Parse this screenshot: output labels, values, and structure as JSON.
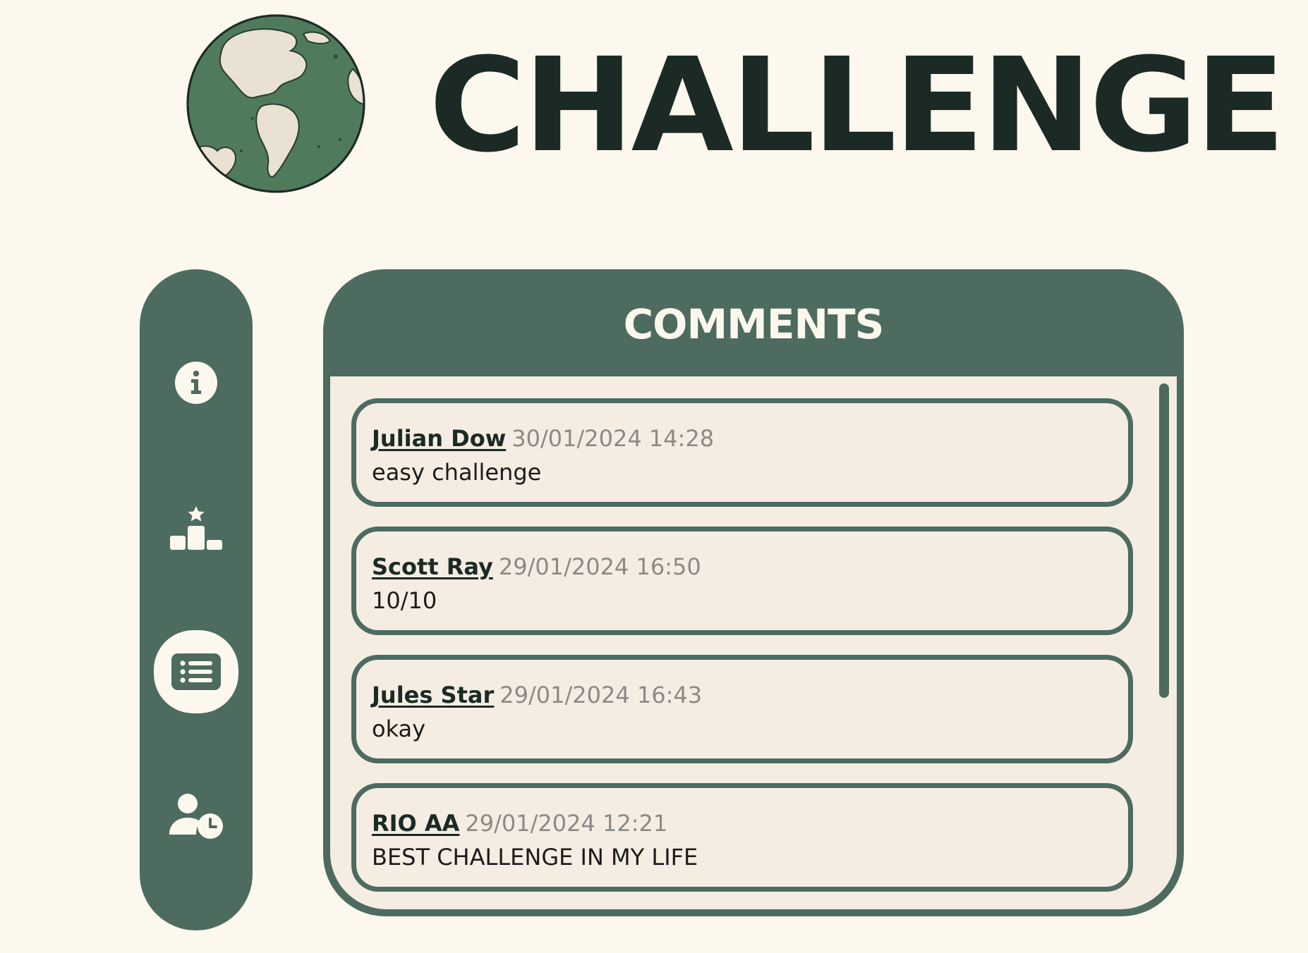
{
  "header": {
    "title": "CHALLENGE",
    "logo_icon": "globe-icon"
  },
  "sidebar": {
    "items": [
      {
        "icon": "info-icon",
        "active": false
      },
      {
        "icon": "podium-icon",
        "active": false
      },
      {
        "icon": "list-icon",
        "active": true
      },
      {
        "icon": "user-clock-icon",
        "active": false
      }
    ]
  },
  "comments": {
    "title": "COMMENTS",
    "items": [
      {
        "author": "Julian Dow",
        "date": "30/01/2024 14:28",
        "text": "easy challenge"
      },
      {
        "author": "Scott Ray",
        "date": "29/01/2024 16:50",
        "text": "10/10"
      },
      {
        "author": "Jules Star",
        "date": "29/01/2024 16:43",
        "text": "okay"
      },
      {
        "author": "RIO AA",
        "date": "29/01/2024 12:21",
        "text": "BEST CHALLENGE IN MY LIFE"
      }
    ]
  },
  "colors": {
    "background": "#fdf8ee",
    "primary": "#4d6b5f",
    "panel_body": "#f5ede2",
    "title_text": "#1b2a24",
    "date_text": "#8a8a86"
  }
}
